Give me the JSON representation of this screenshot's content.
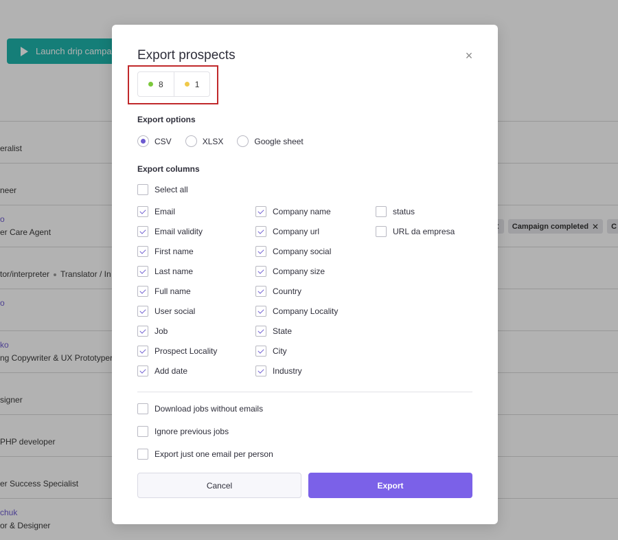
{
  "background": {
    "launch_button": "Launch drip campaign",
    "rows": [
      {
        "job": "eralist"
      },
      {
        "job": "neer"
      },
      {
        "name": "o",
        "job": "er Care Agent"
      },
      {
        "job": "tor/interpreter",
        "job2": "Translator / In"
      },
      {
        "name": "o",
        "job": ""
      },
      {
        "name": "ko",
        "job": "ng Copywriter & UX Prototyper"
      },
      {
        "job": "signer"
      },
      {
        "job": "PHP developer"
      },
      {
        "job": "er Success Specialist"
      },
      {
        "name": "chuk",
        "job": "or & Designer"
      }
    ],
    "tags": [
      "d",
      "Campaign completed",
      "C"
    ]
  },
  "modal": {
    "title": "Export prospects",
    "close_glyph": "×",
    "counts": [
      {
        "value": "8",
        "color": "#7cc83c"
      },
      {
        "value": "1",
        "color": "#f0c94a"
      }
    ],
    "export_options": {
      "label": "Export options",
      "options": [
        "CSV",
        "XLSX",
        "Google sheet"
      ],
      "selected": "CSV"
    },
    "export_columns": {
      "label": "Export columns",
      "select_all": "Select all",
      "col1": [
        "Email",
        "Email validity",
        "First name",
        "Last name",
        "Full name",
        "User social",
        "Job",
        "Prospect Locality",
        "Add date"
      ],
      "col2": [
        "Company name",
        "Company url",
        "Company social",
        "Company size",
        "Country",
        "Company Locality",
        "State",
        "City",
        "Industry"
      ],
      "col3": [
        "status",
        "URL da empresa"
      ]
    },
    "extra_options": [
      "Download jobs without emails",
      "Ignore previous jobs",
      "Export just one email per person"
    ],
    "cancel_label": "Cancel",
    "export_label": "Export",
    "accent_color": "#7b61e8"
  }
}
